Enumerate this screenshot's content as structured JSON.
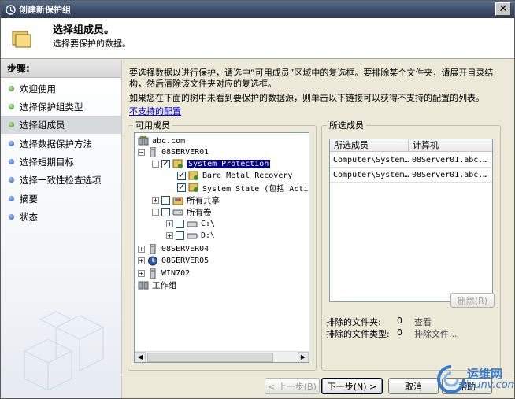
{
  "window": {
    "title": "创建新保护组"
  },
  "header": {
    "title": "选择组成员。",
    "subtitle": "选择要保护的数据。"
  },
  "sidebar": {
    "heading": "步骤:",
    "items": [
      {
        "label": "欢迎使用",
        "status": "done"
      },
      {
        "label": "选择保护组类型",
        "status": "done"
      },
      {
        "label": "选择组成员",
        "status": "current"
      },
      {
        "label": "选择数据保护方法",
        "status": "pending"
      },
      {
        "label": "选择短期目标",
        "status": "pending"
      },
      {
        "label": "选择一致性检查选项",
        "status": "pending"
      },
      {
        "label": "摘要",
        "status": "pending"
      },
      {
        "label": "状态",
        "status": "pending"
      }
    ]
  },
  "main": {
    "intro": "要选择数据以进行保护，请选中“可用成员”区域中的复选框。要排除某个文件夹，请展开目录结构，然后清除该文件夹对应的复选框。",
    "intro2": "如果您在下面的树中未看到要保护的数据源，则单击以下链接可以获得不支持的配置的列表。",
    "link": "不支持的配置",
    "available_label": "可用成员",
    "selected_label": "所选成员"
  },
  "tree": [
    {
      "label": "abc.com",
      "icon": "domain-icon"
    },
    {
      "label": "08SERVER01",
      "icon": "server-icon"
    },
    {
      "label": "System Protection",
      "icon": "system-protection-icon",
      "checked": true,
      "selected": true
    },
    {
      "label": "Bare Metal Recovery",
      "icon": "system-protection-icon",
      "checked": true
    },
    {
      "label": "System State (包括 Active",
      "icon": "system-protection-icon",
      "checked": true
    },
    {
      "label": "所有共享",
      "icon": "share-icon",
      "checked": false
    },
    {
      "label": "所有卷",
      "icon": "volume-icon",
      "checked": false
    },
    {
      "label": "C:\\",
      "icon": "drive-icon",
      "checked": false
    },
    {
      "label": "D:\\",
      "icon": "drive-icon",
      "checked": false
    },
    {
      "label": "08SERVER04",
      "icon": "server-icon"
    },
    {
      "label": "08SERVER05",
      "icon": "dpm-server-icon"
    },
    {
      "label": "WIN702",
      "icon": "server-icon"
    },
    {
      "label": "工作组",
      "icon": "workgroup-icon"
    }
  ],
  "selected_list": {
    "columns": [
      "所选成员",
      "计算机"
    ],
    "rows": [
      [
        "Computer\\System…",
        "08Server01.abc.…"
      ],
      [
        "Computer\\System…",
        "08Server01.abc.…"
      ]
    ]
  },
  "summary": {
    "excluded_folders_label": "排除的文件夹:",
    "excluded_folders_value": "0",
    "excluded_folders_action": "查看",
    "excluded_types_label": "排除的文件类型:",
    "excluded_types_value": "0",
    "excluded_types_action": "排除文件..."
  },
  "buttons": {
    "remove": "删除(R)",
    "back": "< 上一步(B)",
    "next": "下一步(N) >",
    "cancel": "取消",
    "help": "帮助"
  },
  "watermark": {
    "line1": "运维网",
    "line2": "iyunv.com"
  }
}
